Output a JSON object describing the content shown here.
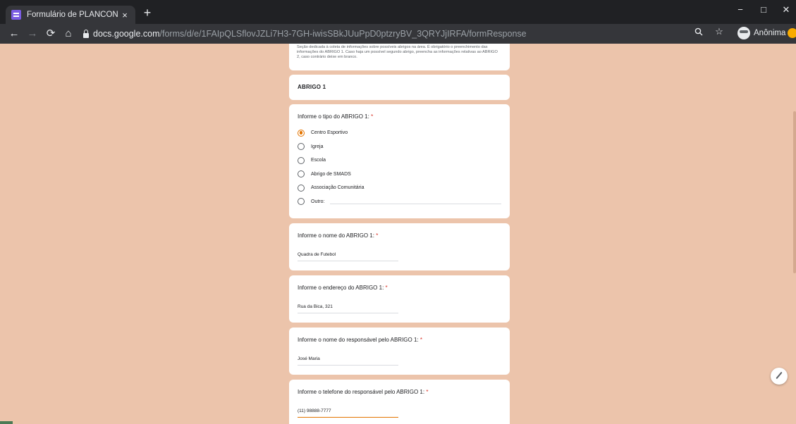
{
  "browser": {
    "tab_title": "Formulário de PLANCON",
    "tab_close": "×",
    "new_tab": "+",
    "url_host": "docs.google.com",
    "url_path": "/forms/d/e/1FAIpQLSflovJZLi7H3-7GH-iwisSBkJUuPpD0ptzryBV_3QRYJjIRFA/formResponse",
    "profile_label": "Anônima",
    "controls": {
      "minimize": "−",
      "maximize": "□",
      "close": "✕"
    },
    "nav": {
      "back": "←",
      "forward": "→",
      "reload": "⟳",
      "home": "⌂"
    },
    "icons": {
      "zoom": "zoom-icon",
      "star": "star-icon",
      "incognito": "incognito-icon"
    }
  },
  "form": {
    "section_description": "Seção dedicada à coleta de informações sobre possíveis abrigos na área. É obrigatório o preenchimento das informações do ABRIGO 1. Caso haja um possível segundo abrigo, preencha as informações relativas ao ABRIGO 2, caso contrário deixe em branco.",
    "section_title": "ABRIGO 1",
    "questions": [
      {
        "title": "Informe o tipo do ABRIGO 1:",
        "required_mark": "*",
        "type": "radio",
        "options": [
          "Centro Esportivo",
          "Igreja",
          "Escola",
          "Abrigo de SMADS",
          "Associação Comunitária",
          "Outro:"
        ],
        "selected": "Centro Esportivo"
      },
      {
        "title": "Informe o nome do ABRIGO 1:",
        "required_mark": "*",
        "value": "Quadra de Futebol"
      },
      {
        "title": "Informe o endereço do ABRIGO 1:",
        "required_mark": "*",
        "value": "Rua da Bica, 321"
      },
      {
        "title": "Informe o nome do responsável pelo ABRIGO 1:",
        "required_mark": "*",
        "value": "José Maria"
      },
      {
        "title": "Informe o telefone do responsável pelo ABRIGO 1:",
        "required_mark": "*",
        "value": "(11) 98888-7777"
      }
    ]
  },
  "colors": {
    "page_background": "#ecc4ab",
    "accent": "#e37400",
    "required": "#d93025"
  }
}
